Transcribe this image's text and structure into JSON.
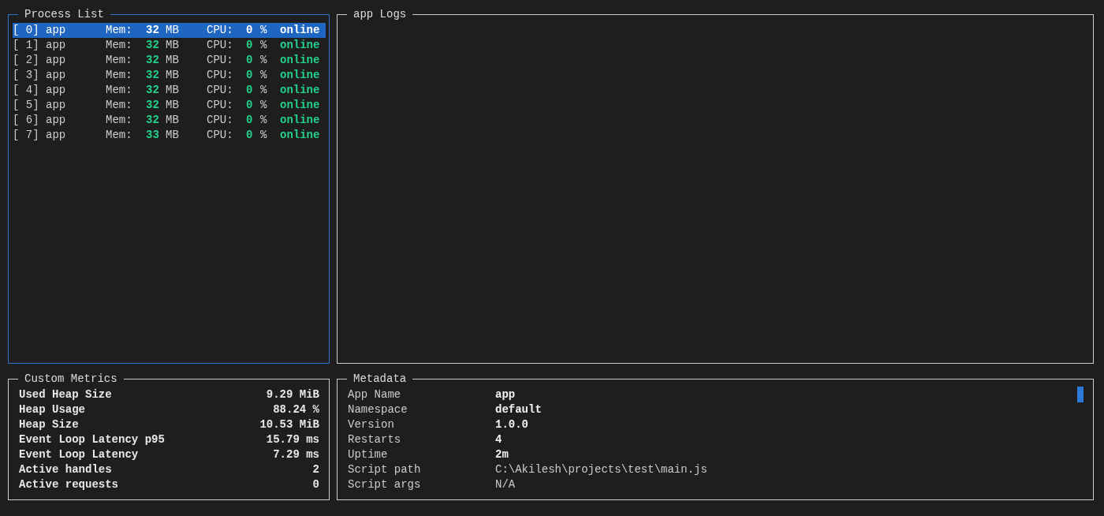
{
  "process_list": {
    "title": "Process List",
    "focused": true,
    "processes": [
      {
        "id": "[ 0]",
        "name": "app",
        "mem_label": "Mem:",
        "mem": "32",
        "mem_unit": "MB",
        "cpu_label": "CPU:",
        "cpu": "0",
        "cpu_unit": "%",
        "status": "online",
        "selected": true
      },
      {
        "id": "[ 1]",
        "name": "app",
        "mem_label": "Mem:",
        "mem": "32",
        "mem_unit": "MB",
        "cpu_label": "CPU:",
        "cpu": "0",
        "cpu_unit": "%",
        "status": "online",
        "selected": false
      },
      {
        "id": "[ 2]",
        "name": "app",
        "mem_label": "Mem:",
        "mem": "32",
        "mem_unit": "MB",
        "cpu_label": "CPU:",
        "cpu": "0",
        "cpu_unit": "%",
        "status": "online",
        "selected": false
      },
      {
        "id": "[ 3]",
        "name": "app",
        "mem_label": "Mem:",
        "mem": "32",
        "mem_unit": "MB",
        "cpu_label": "CPU:",
        "cpu": "0",
        "cpu_unit": "%",
        "status": "online",
        "selected": false
      },
      {
        "id": "[ 4]",
        "name": "app",
        "mem_label": "Mem:",
        "mem": "32",
        "mem_unit": "MB",
        "cpu_label": "CPU:",
        "cpu": "0",
        "cpu_unit": "%",
        "status": "online",
        "selected": false
      },
      {
        "id": "[ 5]",
        "name": "app",
        "mem_label": "Mem:",
        "mem": "32",
        "mem_unit": "MB",
        "cpu_label": "CPU:",
        "cpu": "0",
        "cpu_unit": "%",
        "status": "online",
        "selected": false
      },
      {
        "id": "[ 6]",
        "name": "app",
        "mem_label": "Mem:",
        "mem": "32",
        "mem_unit": "MB",
        "cpu_label": "CPU:",
        "cpu": "0",
        "cpu_unit": "%",
        "status": "online",
        "selected": false
      },
      {
        "id": "[ 7]",
        "name": "app",
        "mem_label": "Mem:",
        "mem": "33",
        "mem_unit": "MB",
        "cpu_label": "CPU:",
        "cpu": "0",
        "cpu_unit": "%",
        "status": "online",
        "selected": false
      }
    ]
  },
  "logs": {
    "title": "app Logs"
  },
  "custom_metrics": {
    "title": "Custom Metrics",
    "rows": [
      {
        "label": "Used Heap Size",
        "value": "9.29 MiB"
      },
      {
        "label": "Heap Usage",
        "value": "88.24 %"
      },
      {
        "label": "Heap Size",
        "value": "10.53 MiB"
      },
      {
        "label": "Event Loop Latency p95",
        "value": "15.79 ms"
      },
      {
        "label": "Event Loop Latency",
        "value": "7.29 ms"
      },
      {
        "label": "Active handles",
        "value": "2"
      },
      {
        "label": "Active requests",
        "value": "0"
      }
    ]
  },
  "metadata": {
    "title": "Metadata",
    "rows": [
      {
        "label": "App Name",
        "value": "app"
      },
      {
        "label": "Namespace",
        "value": "default"
      },
      {
        "label": "Version",
        "value": "1.0.0"
      },
      {
        "label": "Restarts",
        "value": "4"
      },
      {
        "label": "Uptime",
        "value": "2m"
      },
      {
        "label": "Script path",
        "value": "C:\\Akilesh\\projects\\test\\main.js",
        "plain": true
      },
      {
        "label": "Script args",
        "value": "N/A",
        "plain": true
      }
    ]
  }
}
